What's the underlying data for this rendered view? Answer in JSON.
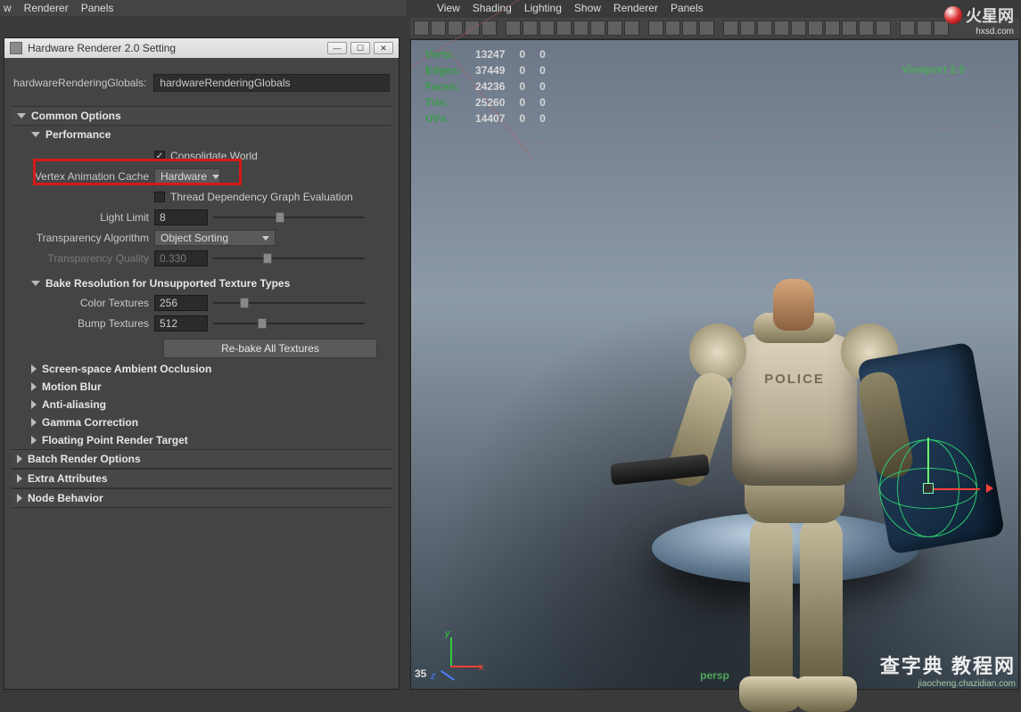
{
  "menus_left": [
    "w",
    "Renderer",
    "Panels"
  ],
  "menus_right": [
    "View",
    "Shading",
    "Lighting",
    "Show",
    "Renderer",
    "Panels"
  ],
  "panel": {
    "title": "Hardware Renderer 2.0 Setting",
    "globals_label": "hardwareRenderingGlobals:",
    "globals_value": "hardwareRenderingGlobals",
    "common_options": "Common Options",
    "performance": {
      "header": "Performance",
      "consolidate_world_label": "Consolidate World",
      "consolidate_world_checked": true,
      "vac_label": "Vertex Animation Cache",
      "vac_value": "Hardware",
      "thread_label": "Thread Dependency Graph Evaluation",
      "thread_checked": false,
      "light_limit_label": "Light Limit",
      "light_limit_value": "8",
      "trans_alg_label": "Transparency Algorithm",
      "trans_alg_value": "Object Sorting",
      "trans_q_label": "Transparency Quality",
      "trans_q_value": "0.330"
    },
    "bake": {
      "header": "Bake Resolution for Unsupported Texture Types",
      "color_label": "Color Textures",
      "color_value": "256",
      "bump_label": "Bump Textures",
      "bump_value": "512",
      "rebake_btn": "Re-bake All Textures"
    },
    "collapsed": [
      "Screen-space Ambient Occlusion",
      "Motion Blur",
      "Anti-aliasing",
      "Gamma Correction",
      "Floating Point Render Target",
      "Batch Render Options",
      "Extra Attributes",
      "Node Behavior"
    ]
  },
  "viewport": {
    "renderer_label": "Viewport 2.0",
    "frame": "35",
    "camera": "persp",
    "axes": {
      "x": "x",
      "y": "y",
      "z": "z"
    },
    "hud": {
      "rows": [
        {
          "label": "Verts:",
          "v1": "13247",
          "v2": "0",
          "v3": "0"
        },
        {
          "label": "Edges:",
          "v1": "37449",
          "v2": "0",
          "v3": "0"
        },
        {
          "label": "Faces:",
          "v1": "24236",
          "v2": "0",
          "v3": "0"
        },
        {
          "label": "Tris:",
          "v1": "25260",
          "v2": "0",
          "v3": "0"
        },
        {
          "label": "UVs:",
          "v1": "14407",
          "v2": "0",
          "v3": "0"
        }
      ]
    }
  },
  "watermarks": {
    "top_brand": "火星网",
    "top_domain": "hxsd.com",
    "bottom_cn": "查字典 教程网",
    "bottom_en": "jiaocheng.chazidian.com"
  }
}
